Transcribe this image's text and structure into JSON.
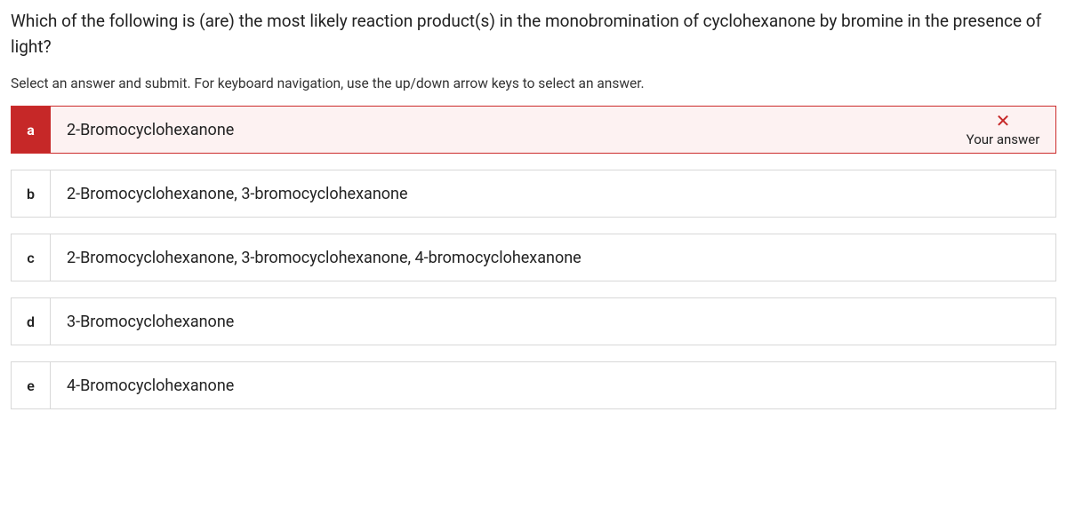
{
  "question": "Which of the following is (are) the most likely reaction product(s) in the monobromination of cyclohexanone by bromine in the presence of light?",
  "instructions": "Select an answer and submit. For keyboard navigation, use the up/down arrow keys to select an answer.",
  "feedback_label": "Your answer",
  "x_glyph": "✕",
  "options": [
    {
      "key": "a",
      "text": "2-Bromocyclohexanone",
      "selected_wrong": true
    },
    {
      "key": "b",
      "text": "2-Bromocyclohexanone, 3-bromocyclohexanone",
      "selected_wrong": false
    },
    {
      "key": "c",
      "text": "2-Bromocyclohexanone, 3-bromocyclohexanone, 4-bromocyclohexanone",
      "selected_wrong": false
    },
    {
      "key": "d",
      "text": "3-Bromocyclohexanone",
      "selected_wrong": false
    },
    {
      "key": "e",
      "text": "4-Bromocyclohexanone",
      "selected_wrong": false
    }
  ]
}
